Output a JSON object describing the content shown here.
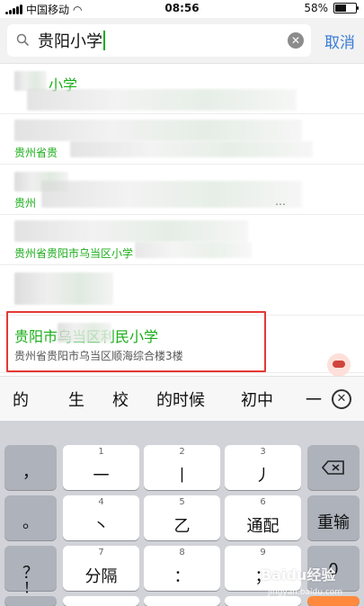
{
  "status_bar": {
    "carrier": "中国移动",
    "time": "08:56",
    "battery": "58%",
    "battery_level": 0.58
  },
  "search": {
    "query": "贵阳小学",
    "cancel_label": "取消"
  },
  "results": [
    {
      "name": "小学",
      "address": ""
    },
    {
      "name": "",
      "address": "贵州省贵"
    },
    {
      "name": "",
      "address": "贵州"
    },
    {
      "name": "",
      "address": "贵州省贵阳市乌当区小学"
    },
    {
      "name": "",
      "address": ""
    },
    {
      "name": "贵阳市乌当区利民小学",
      "address": "贵州省贵阳市乌当区顺海综合楼3楼"
    }
  ],
  "candidates": [
    "的",
    "生",
    "校",
    "的时候",
    "初中",
    "一"
  ],
  "keyboard": {
    "row1": [
      {
        "label": "，"
      },
      {
        "num": "1",
        "label": "一"
      },
      {
        "num": "2",
        "label": "丨"
      },
      {
        "num": "3",
        "label": "丿"
      }
    ],
    "row2": [
      {
        "label": "。"
      },
      {
        "num": "4",
        "label": "丶"
      },
      {
        "num": "5",
        "label": "乙"
      },
      {
        "num": "6",
        "label": "通配"
      },
      {
        "label": "重输"
      }
    ],
    "row3": [
      {
        "label": "？"
      },
      {
        "num": "7",
        "label": "分隔"
      },
      {
        "num": "8",
        "label": "："
      },
      {
        "num": "9",
        "label": "；"
      },
      {
        "label": "0"
      }
    ],
    "row4": [
      {
        "label": "！"
      }
    ]
  },
  "watermark": {
    "text": "Baidu经验",
    "sub": "jingyan.baidu.com"
  }
}
